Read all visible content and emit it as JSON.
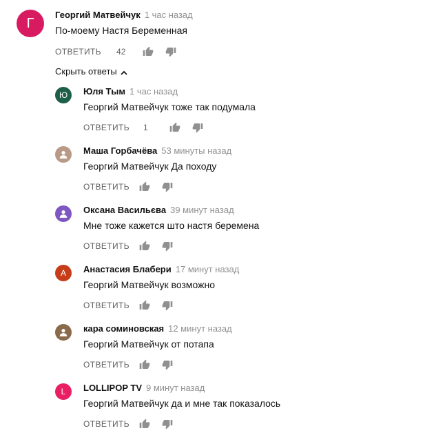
{
  "top_comment": {
    "avatar_letter": "Г",
    "avatar_color": "#d81b60",
    "author": "Георгий Матвейчук",
    "time": "1 час назад",
    "text": "По-моему Настя Беременная",
    "reply_label": "ОТВЕТИТЬ",
    "likes": "42",
    "like_icon": "thumbs-up-icon",
    "dislike_icon": "thumbs-down-icon"
  },
  "replies_toggle": {
    "label": "Скрыть ответы",
    "icon": "chevron-up-icon"
  },
  "replies": [
    {
      "avatar_letter": "Ю",
      "avatar_color": "#1e5f4a",
      "author": "Юля Тым",
      "time": "1 час назад",
      "text": "Георгий Матвейчук тоже так подумала",
      "reply_label": "ОТВЕТИТЬ",
      "likes": "1"
    },
    {
      "avatar_letter": "",
      "avatar_color": "#b89a86",
      "author": "Маша Горбачёва",
      "time": "53 минуты назад",
      "text": "Георгий Матвейчук Да походу",
      "reply_label": "ОТВЕТИТЬ",
      "likes": ""
    },
    {
      "avatar_letter": "",
      "avatar_color": "#7e57c2",
      "author": "Оксана Васильєва",
      "time": "39 минут назад",
      "text": "Мне тоже кажется што настя беремена",
      "reply_label": "ОТВЕТИТЬ",
      "likes": ""
    },
    {
      "avatar_letter": "А",
      "avatar_color": "#c73d1a",
      "author": "Анастасия Блабери",
      "time": "17 минут назад",
      "text": "Георгий Матвейчук возможно",
      "reply_label": "ОТВЕТИТЬ",
      "likes": ""
    },
    {
      "avatar_letter": "",
      "avatar_color": "#8a6a4a",
      "author": "кара соминовская",
      "time": "12 минут назад",
      "text": "Георгий Матвейчук от потапа",
      "reply_label": "ОТВЕТИТЬ",
      "likes": ""
    },
    {
      "avatar_letter": "L",
      "avatar_color": "#e91e63",
      "author": "LOLLIPOP TV",
      "time": "9 минут назад",
      "text": "Георгий Матвейчук  да и мне так показалось",
      "reply_label": "ОТВЕТИТЬ",
      "likes": ""
    }
  ]
}
